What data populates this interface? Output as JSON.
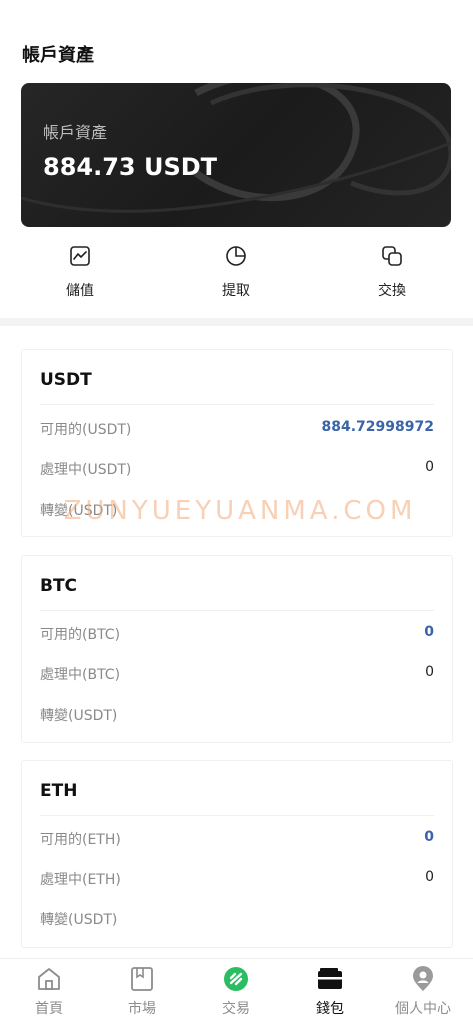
{
  "header": {
    "title": "帳戶資產"
  },
  "asset_card": {
    "label": "帳戶資產",
    "value": "884.73 USDT"
  },
  "actions": [
    {
      "label": "儲值",
      "icon": "chart-line-icon"
    },
    {
      "label": "提取",
      "icon": "pie-chart-icon"
    },
    {
      "label": "交換",
      "icon": "exchange-icon"
    }
  ],
  "coins": [
    {
      "name": "USDT",
      "rows": [
        {
          "label": "可用的(USDT)",
          "value": "884.72998972"
        },
        {
          "label": "處理中(USDT)",
          "value": "0"
        },
        {
          "label": "轉變(USDT)",
          "value": ""
        }
      ]
    },
    {
      "name": "BTC",
      "rows": [
        {
          "label": "可用的(BTC)",
          "value": "0"
        },
        {
          "label": "處理中(BTC)",
          "value": "0"
        },
        {
          "label": "轉變(USDT)",
          "value": ""
        }
      ]
    },
    {
      "name": "ETH",
      "rows": [
        {
          "label": "可用的(ETH)",
          "value": "0"
        },
        {
          "label": "處理中(ETH)",
          "value": "0"
        },
        {
          "label": "轉變(USDT)",
          "value": ""
        }
      ]
    }
  ],
  "watermark": "ZUNYUEYUANMA.COM",
  "tabbar": [
    {
      "label": "首頁",
      "icon": "home-icon"
    },
    {
      "label": "市場",
      "icon": "bookmark-icon"
    },
    {
      "label": "交易",
      "icon": "trade-icon"
    },
    {
      "label": "錢包",
      "icon": "wallet-icon",
      "active": true
    },
    {
      "label": "個人中心",
      "icon": "user-location-icon"
    }
  ],
  "colors": {
    "accent_blue": "#3a63a8",
    "trade_green": "#2bbd62",
    "card_dark": "#1f1f1f"
  }
}
